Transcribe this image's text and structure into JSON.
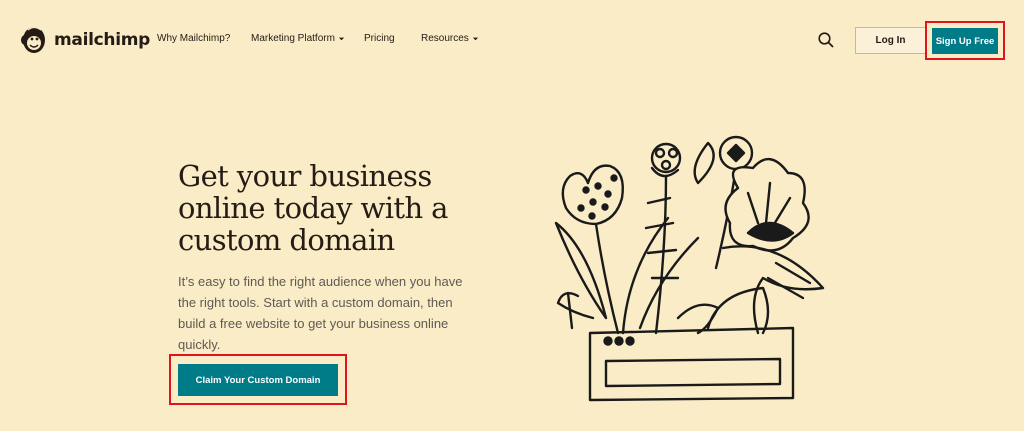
{
  "brand": {
    "name": "mailchimp",
    "logo_icon": "freddie-monkey-icon"
  },
  "nav": {
    "items": [
      {
        "label": "Why Mailchimp?",
        "has_dropdown": false
      },
      {
        "label": "Marketing Platform",
        "has_dropdown": true
      },
      {
        "label": "Pricing",
        "has_dropdown": false
      },
      {
        "label": "Resources",
        "has_dropdown": true
      }
    ]
  },
  "header": {
    "search_icon": "search-icon",
    "login_label": "Log In",
    "signup_label": "Sign Up Free"
  },
  "hero": {
    "title_lines": [
      "Get your business",
      "online today with a",
      "custom domain"
    ],
    "description_lines": [
      "It’s easy to find the right audience when you have",
      "the right tools. Start with a custom domain, then",
      "build a free website to get your business online",
      "quickly."
    ],
    "cta_label": "Claim Your Custom Domain",
    "illustration": "flower-pot-illustration"
  },
  "colors": {
    "background": "#f9ecc7",
    "accent": "#007c89",
    "highlight_box": "#e0141e",
    "text": "#241c15"
  }
}
